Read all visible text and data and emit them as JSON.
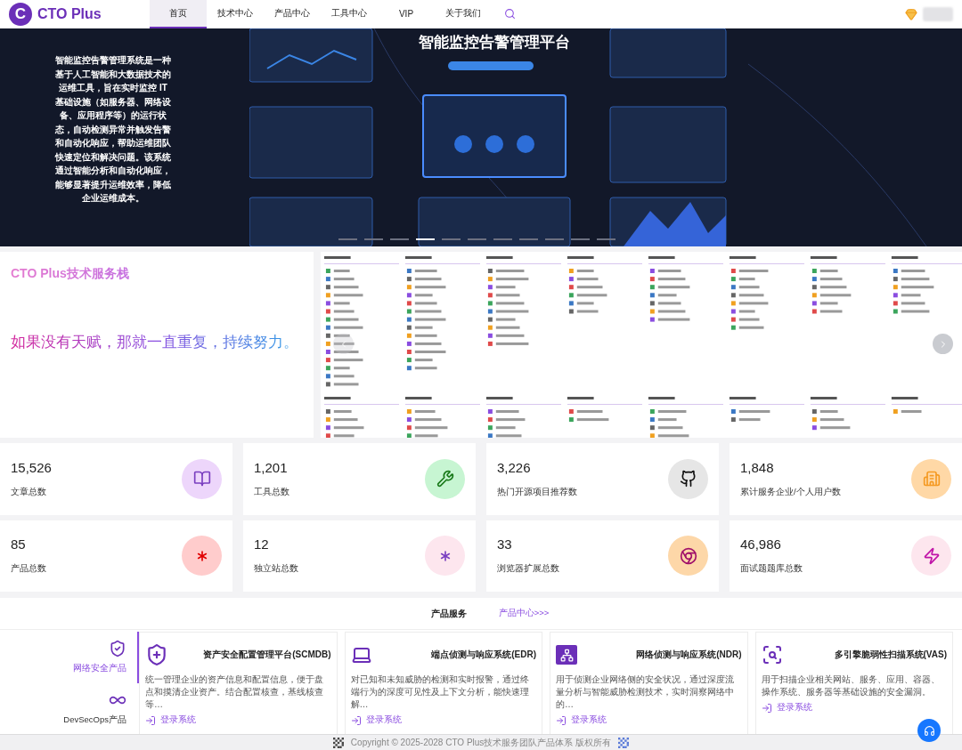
{
  "header": {
    "logo": {
      "mark": "C",
      "name": "CTO Plus"
    },
    "nav": [
      {
        "label": "首页",
        "selected": true
      },
      {
        "label": "技术中心",
        "selected": false
      },
      {
        "label": "产品中心",
        "selected": false
      },
      {
        "label": "工具中心",
        "selected": false
      },
      {
        "label": "VIP",
        "selected": false
      },
      {
        "label": "关于我们",
        "selected": false
      }
    ]
  },
  "banner": {
    "description": "智能监控告警管理系统是一种基于人工智能和大数据技术的运维工具，旨在实时监控 IT 基础设施（如服务器、网络设备、应用程序等）的运行状态，自动检测异常并触发告警和自动化响应，帮助运维团队快速定位和解决问题。该系统通过智能分析和自动化响应，能够显著提升运维效率，降低企业运维成本。",
    "title": "智能监控告警管理平台",
    "dots": [
      {
        "selected": false
      },
      {
        "selected": false
      },
      {
        "selected": false
      },
      {
        "selected": true
      },
      {
        "selected": false
      },
      {
        "selected": false
      },
      {
        "selected": false
      },
      {
        "selected": false
      },
      {
        "selected": false
      },
      {
        "selected": false
      },
      {
        "selected": false
      }
    ]
  },
  "tech_stack": {
    "title": "CTO Plus技术服务栈",
    "slogan": "如果没有天赋，那就一直重复，持续努力。"
  },
  "stats": [
    {
      "value": "15,526",
      "label": "文章总数"
    },
    {
      "value": "1,201",
      "label": "工具总数"
    },
    {
      "value": "3,226",
      "label": "热门开源项目推荐数"
    },
    {
      "value": "1,848",
      "label": "累计服务企业/个人用户数"
    },
    {
      "value": "85",
      "label": "产品总数"
    },
    {
      "value": "12",
      "label": "独立站总数"
    },
    {
      "value": "33",
      "label": "浏览器扩展总数"
    },
    {
      "value": "46,986",
      "label": "面试题题库总数"
    }
  ],
  "products": {
    "title": "产品服务",
    "more_link": "产品中心>>>",
    "categories": [
      {
        "label": "网络安全产品",
        "selected": true
      },
      {
        "label": "DevSecOps产品",
        "selected": false
      }
    ],
    "items": [
      {
        "name": "资产安全配置管理平台(SCMDB)",
        "description": "统一管理企业的资产信息和配置信息，便于盘点和摸清企业资产。结合配置核查，基线核查等…",
        "link": "登录系统"
      },
      {
        "name": "端点侦测与响应系统(EDR)",
        "description": "对已知和未知威胁的检测和实时报警，通过终端行为的深度可见性及上下文分析，能快速理解…",
        "link": "登录系统"
      },
      {
        "name": "网络侦测与响应系统(NDR)",
        "description": "用于侦测企业网络侧的安全状况，通过深度流量分析与智能威胁检测技术，实时洞察网络中的…",
        "link": "登录系统"
      },
      {
        "name": "多引擎脆弱性扫描系统(VAS)",
        "description": "用于扫描企业相关网站、服务、应用、容器、操作系统、服务器等基础设施的安全漏洞。",
        "link": "登录系统"
      }
    ]
  },
  "footer": {
    "copyright": "Copyright © 2025-2028 CTO Plus技术服务团队产品体系 版权所有"
  }
}
